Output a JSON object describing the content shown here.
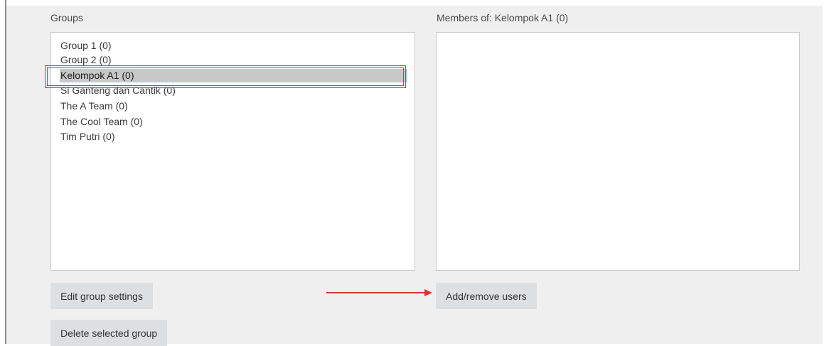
{
  "groups": {
    "label": "Groups",
    "items": [
      {
        "label": "Group 1 (0)",
        "selected": false
      },
      {
        "label": "Group 2 (0)",
        "selected": false
      },
      {
        "label": "Kelompok A1 (0)",
        "selected": true
      },
      {
        "label": "Si Ganteng dan Cantik (0)",
        "selected": false
      },
      {
        "label": "The A Team (0)",
        "selected": false
      },
      {
        "label": "The Cool Team (0)",
        "selected": false
      },
      {
        "label": "Tim Putri (0)",
        "selected": false
      }
    ]
  },
  "members": {
    "label": "Members of: Kelompok A1 (0)",
    "items": []
  },
  "buttons": {
    "edit_group_settings": "Edit group settings",
    "add_remove_users": "Add/remove users",
    "delete_selected_group": "Delete selected group"
  },
  "colors": {
    "panel_background": "#efefef",
    "selected_item": "#c8c8c8",
    "button_background": "#dde0e3",
    "annotation_red": "#dd3434"
  }
}
